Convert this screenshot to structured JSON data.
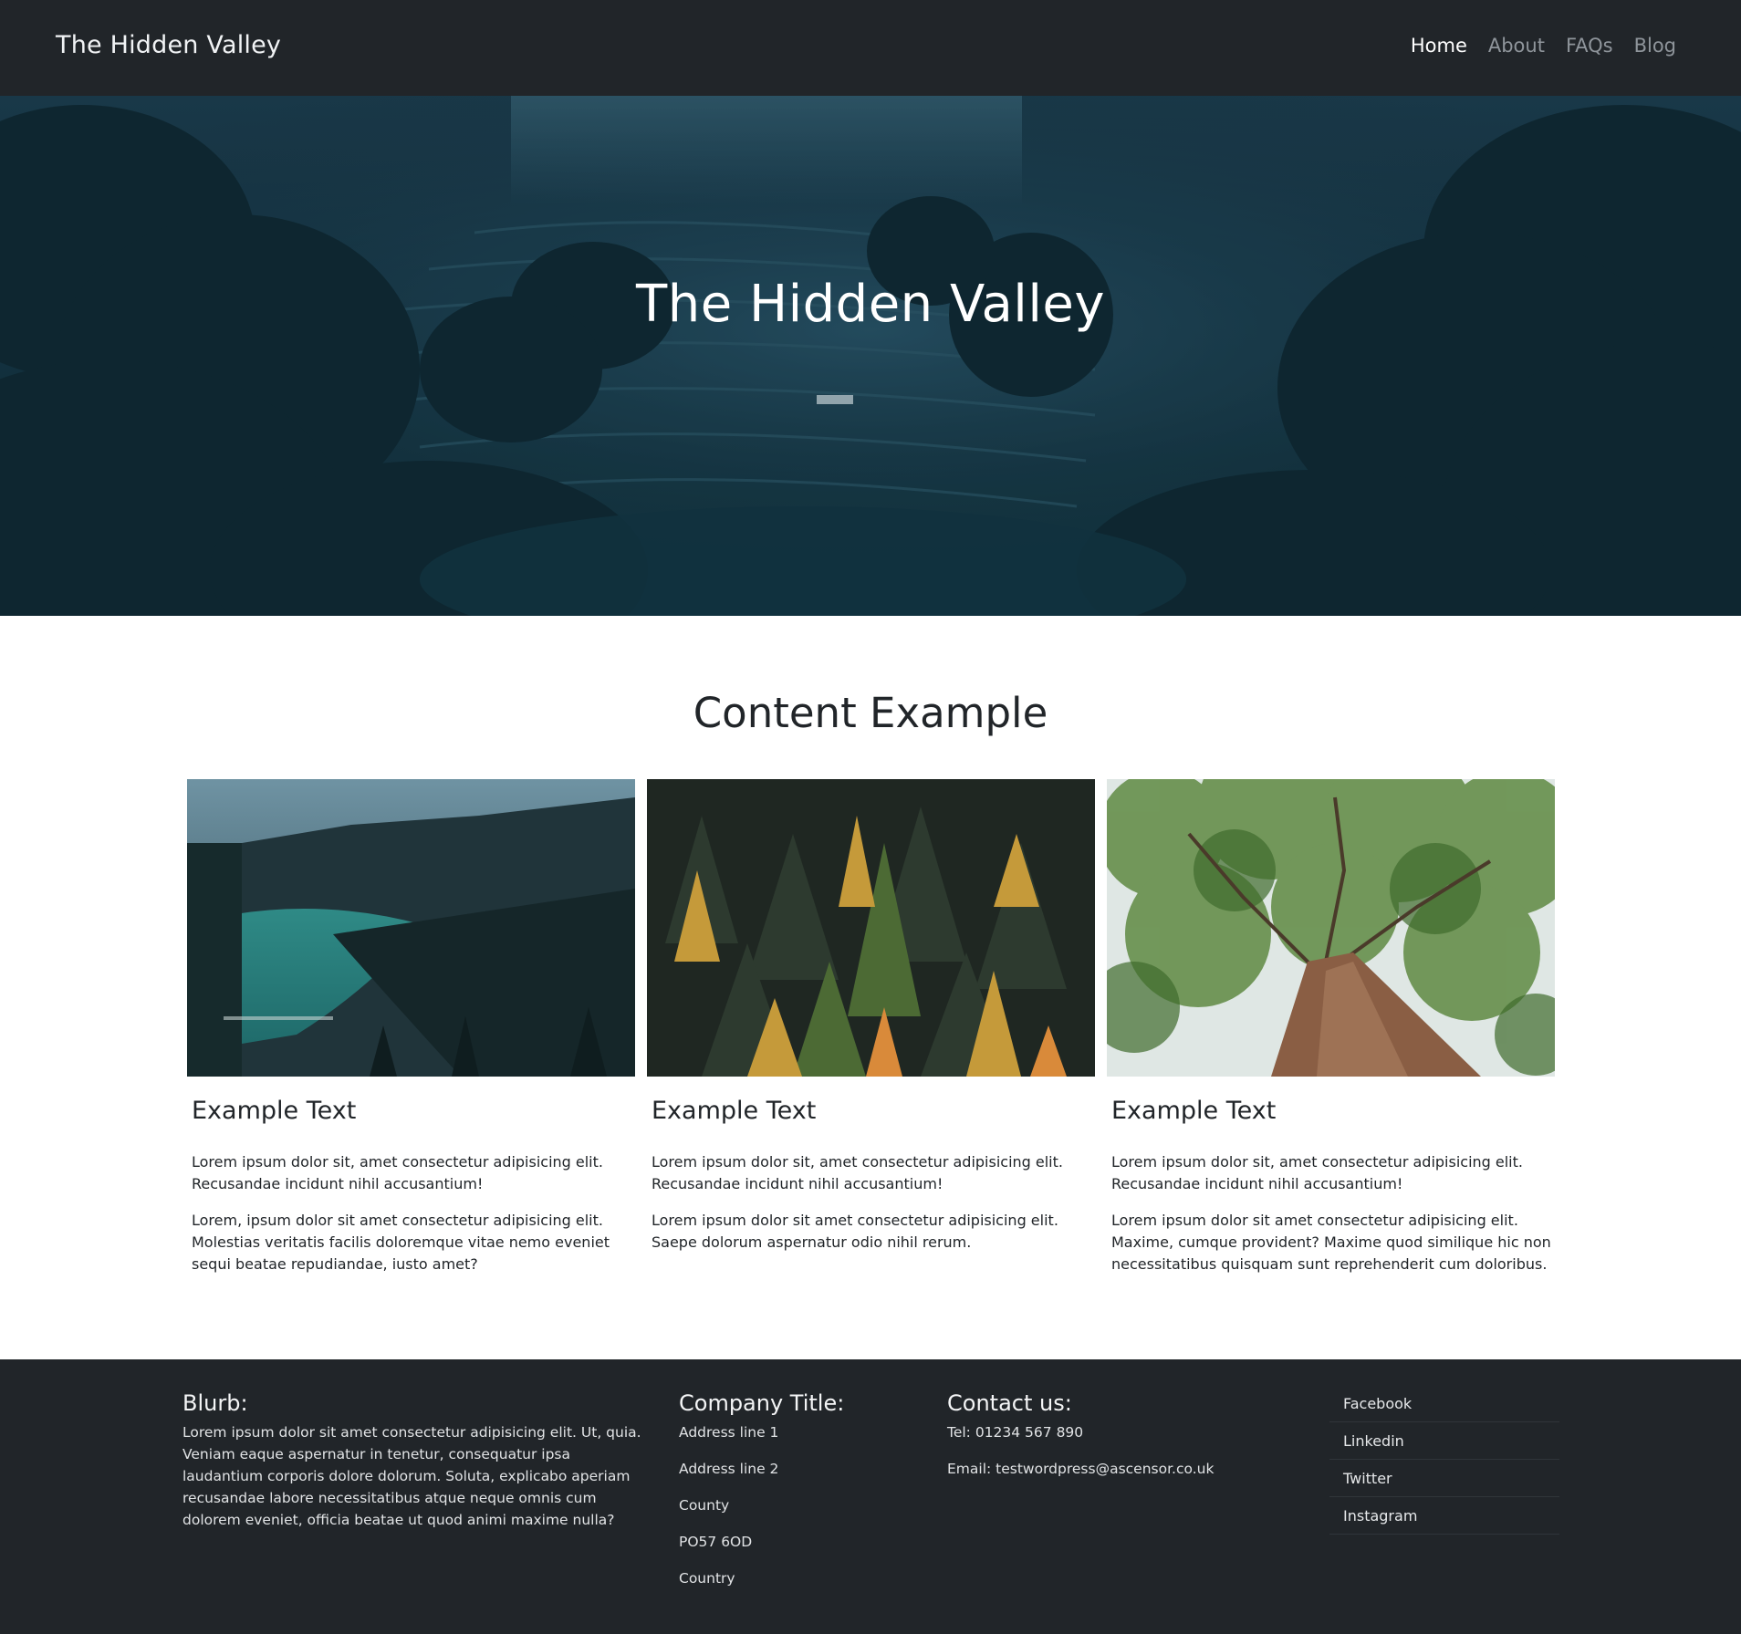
{
  "navbar": {
    "brand": "The Hidden Valley",
    "links": [
      {
        "label": "Home",
        "active": true
      },
      {
        "label": "About",
        "active": false
      },
      {
        "label": "FAQs",
        "active": false
      },
      {
        "label": "Blog",
        "active": false
      }
    ]
  },
  "hero": {
    "title": "The Hidden Valley"
  },
  "content": {
    "title": "Content Example",
    "cards": [
      {
        "title": "Example Text",
        "paragraphs": [
          "Lorem ipsum dolor sit, amet consectetur adipisicing elit. Recusandae incidunt nihil accusantium!",
          "Lorem, ipsum dolor sit amet consectetur adipisicing elit. Molestias veritatis facilis doloremque vitae nemo eveniet sequi beatae repudiandae, iusto amet?"
        ]
      },
      {
        "title": "Example Text",
        "paragraphs": [
          "Lorem ipsum dolor sit, amet consectetur adipisicing elit. Recusandae incidunt nihil accusantium!",
          "Lorem ipsum dolor sit amet consectetur adipisicing elit. Saepe dolorum aspernatur odio nihil rerum."
        ]
      },
      {
        "title": "Example Text",
        "paragraphs": [
          "Lorem ipsum dolor sit, amet consectetur adipisicing elit. Recusandae incidunt nihil accusantium!",
          "Lorem ipsum dolor sit amet consectetur adipisicing elit. Maxime, cumque provident? Maxime quod similique hic non necessitatibus quisquam sunt reprehenderit cum doloribus."
        ]
      }
    ]
  },
  "footer": {
    "blurb": {
      "title": "Blurb:",
      "text": "Lorem ipsum dolor sit amet consectetur adipisicing elit. Ut, quia. Veniam eaque aspernatur in tenetur, consequatur ipsa laudantium corporis dolore dolorum. Soluta, explicabo aperiam recusandae labore necessitatibus atque neque omnis cum dolorem eveniet, officia beatae ut quod animi maxime nulla?"
    },
    "company": {
      "title": "Company Title:",
      "lines": [
        "Address line 1",
        "Address line 2",
        "County",
        "PO57 6OD",
        "Country"
      ]
    },
    "contact": {
      "title": "Contact us:",
      "tel": "Tel: 01234 567 890",
      "email": "Email: testwordpress@ascensor.co.uk"
    },
    "social": [
      "Facebook",
      "Linkedin",
      "Twitter",
      "Instagram"
    ]
  },
  "colors": {
    "navbar_bg": "#212529",
    "footer_bg": "#212529",
    "hero_tint": "#163545",
    "text_dark": "#212529",
    "nav_inactive": "#8f959b"
  }
}
